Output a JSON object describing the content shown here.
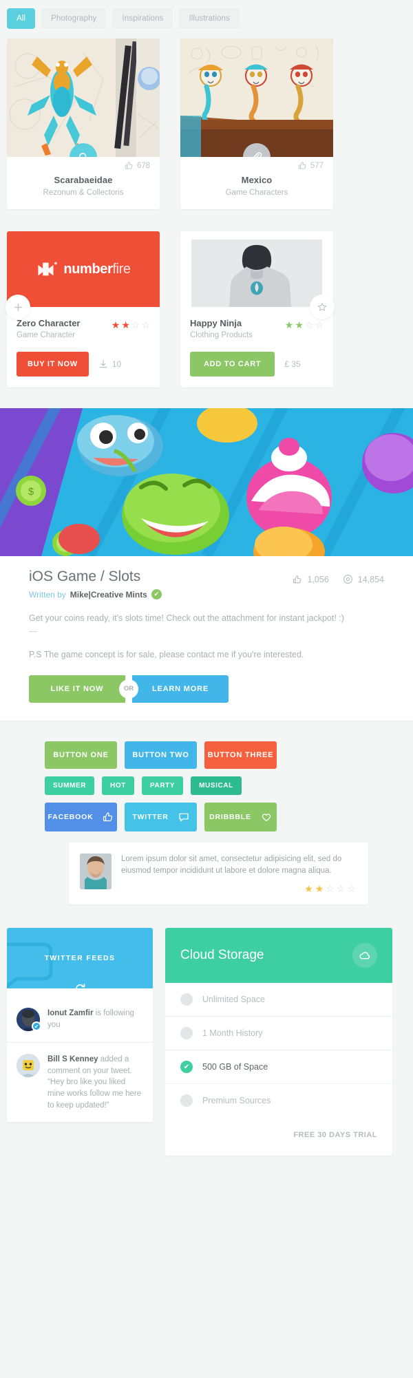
{
  "filters": [
    {
      "label": "All",
      "active": true
    },
    {
      "label": "Photography",
      "active": false
    },
    {
      "label": "Inspirations",
      "active": false
    },
    {
      "label": "Illustrations",
      "active": false
    }
  ],
  "shots": [
    {
      "title": "Scarabaeidae",
      "subtitle": "Rezonum & Collectoris",
      "likes": "678",
      "fab_icon": "search-icon",
      "fab_color": "#5bcfdd"
    },
    {
      "title": "Mexico",
      "subtitle": "Game Characters",
      "likes": "577",
      "fab_icon": "attachment-icon",
      "fab_color": "#c3c6c8"
    }
  ],
  "products": [
    {
      "brand": "number",
      "brand_light": "fire",
      "name": "Zero Character",
      "category": "Game Character",
      "rating": 2,
      "rating_max": 4,
      "star_color": "#ef4f37",
      "cta": "BUY IT NOW",
      "meta_icon": "download-icon",
      "meta_value": "10",
      "thumb_color": "#ef4f37",
      "corner_icon": "plus-icon"
    },
    {
      "name": "Happy Ninja",
      "category": "Clothing Products",
      "rating": 2,
      "rating_max": 4,
      "star_color": "#8bc765",
      "cta": "ADD TO CART",
      "meta_icon": "pound-icon",
      "meta_value": "£  35",
      "corner_icon": "star-icon"
    }
  ],
  "article": {
    "title": "iOS Game / Slots",
    "written_by_prefix": "Written by",
    "author": "Mike|Creative Mints",
    "verified_icon": "check-icon",
    "likes_icon": "thumb-up-icon",
    "likes": "1,056",
    "views_icon": "eye-icon",
    "views": "14,854",
    "paragraph1": "Get your coins ready, it's slots time! Check out the attachment for instant jackpot! :)",
    "divider": "—",
    "paragraph2": "P.S The game concept is for sale, please contact me if you're interested.",
    "btn_left": "LIKE IT NOW",
    "btn_or": "OR",
    "btn_right": "LEARN MORE"
  },
  "showcase": {
    "big_buttons": [
      {
        "label": "BUTTON ONE",
        "color": "#8bc765"
      },
      {
        "label": "BUTTON TWO",
        "color": "#42b6e8"
      },
      {
        "label": "BUTTON THREE",
        "color": "#f5603e"
      }
    ],
    "tags": [
      {
        "label": "SUMMER",
        "color": "#3ecfa0"
      },
      {
        "label": "HOT",
        "color": "#3ecfa0"
      },
      {
        "label": "PARTY",
        "color": "#3ecfa0"
      },
      {
        "label": "MUSICAL",
        "color": "#2fbb90"
      }
    ],
    "socials": [
      {
        "label": "FACEBOOK",
        "color": "#5290e8",
        "icon": "thumb-up-icon"
      },
      {
        "label": "TWITTER",
        "color": "#44c2e8",
        "icon": "comment-icon"
      },
      {
        "label": "DRIBBBLE",
        "color": "#8bc765",
        "icon": "heart-icon"
      }
    ]
  },
  "testimonial": {
    "text": "Lorem ipsum dolor sit amet, consectetur adipisicing elit, sed do eiusmod tempor incididunt ut labore et dolore magna aliqua.",
    "rating": 2,
    "rating_max": 5,
    "star_color": "#f6c342"
  },
  "twitter": {
    "header": "TWITTER FEEDS",
    "refresh_icon": "refresh-icon",
    "items": [
      {
        "name": "Ionut Zamfir",
        "text": " is following you",
        "verified": true
      },
      {
        "name": "Bill S Kenney",
        "text": " added a comment on your tweet. “Hey bro like you liked mine works follow me here to keep updated!”",
        "verified": false
      }
    ]
  },
  "cloud": {
    "title": "Cloud Storage",
    "icon": "cloud-icon",
    "items": [
      {
        "label": "Unlimited Space",
        "active": false
      },
      {
        "label": "1 Month History",
        "active": false
      },
      {
        "label": "500 GB of Space",
        "active": true
      },
      {
        "label": "Premium Sources",
        "active": false
      }
    ],
    "trial": "FREE 30 DAYS TRIAL"
  }
}
